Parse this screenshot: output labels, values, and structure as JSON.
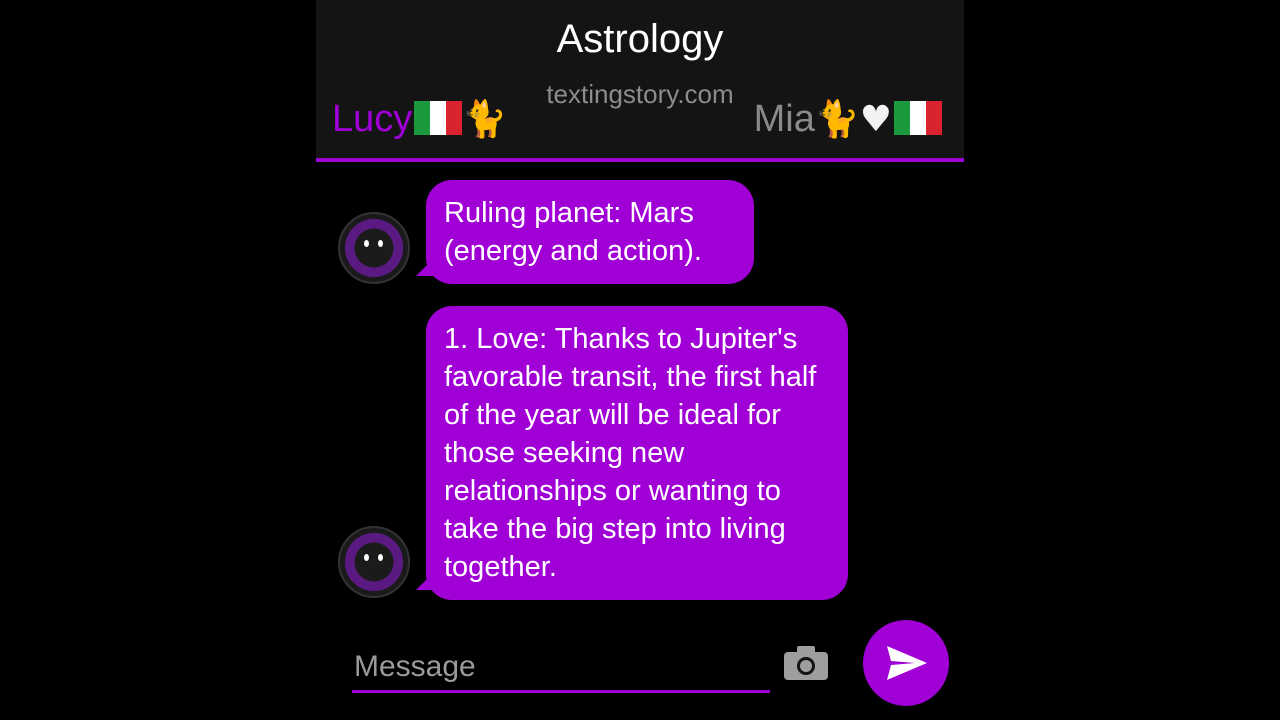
{
  "header": {
    "title": "Astrology",
    "watermark": "textingstory.com",
    "left_contact": {
      "name": "Lucy",
      "emojis": [
        "italy-flag",
        "black-cat"
      ]
    },
    "right_contact": {
      "name": "Mia",
      "emojis": [
        "cat",
        "white-heart",
        "italy-flag"
      ]
    }
  },
  "messages": [
    {
      "sender": "Lucy",
      "text": "Ruling planet: Mars (energy and action)."
    },
    {
      "sender": "Lucy",
      "text": "1. Love: Thanks to Jupiter's favorable transit, the first half of the year will be ideal for those seeking new relationships or wanting to take the big step into living together."
    }
  ],
  "composer": {
    "placeholder": "Message",
    "camera_icon": "camera-icon",
    "send_icon": "send-icon"
  },
  "colors": {
    "accent": "#a000d6",
    "header_bg": "#141414",
    "background": "#000000"
  }
}
